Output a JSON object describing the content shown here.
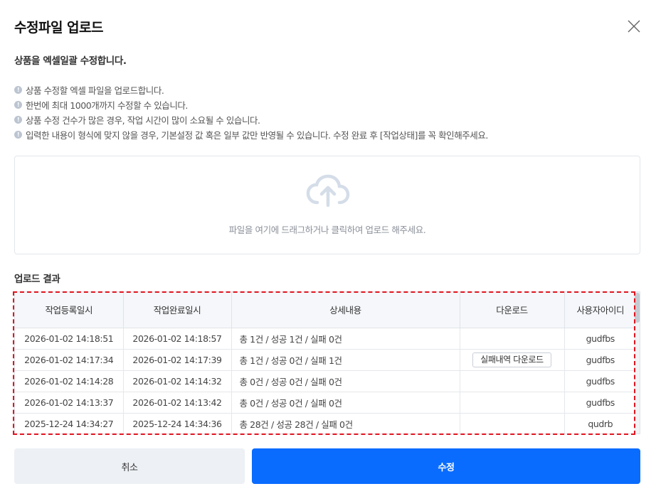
{
  "dialog": {
    "title": "수정파일 업로드",
    "subtitle": "상품을 엑셀일괄 수정합니다.",
    "notices": [
      "상품 수정할 엑셀 파일을 업로드합니다.",
      "한번에 최대 1000개까지 수정할 수 있습니다.",
      "상품 수정 건수가 많은 경우, 작업 시간이 많이 소요될 수 있습니다.",
      "입력한 내용이 형식에 맞지 않을 경우, 기본설정 값 혹은 일부 값만 반영될 수 있습니다. 수정 완료 후 [작업상태]를 꼭 확인해주세요."
    ],
    "info_icon_glyph": "!",
    "close_icon": "close-icon"
  },
  "dropzone": {
    "text": "파일을 여기에 드래그하거나 클릭하여 업로드 해주세요.",
    "icon": "cloud-upload-icon",
    "icon_color": "#d4dde8"
  },
  "results": {
    "title": "업로드 결과",
    "columns": [
      "작업등록일시",
      "작업완료일시",
      "상세내용",
      "다운로드",
      "사용자아이디"
    ],
    "rows": [
      {
        "registered": "2026-01-02 14:18:51",
        "completed": "2026-01-02 14:18:57",
        "detail": "총 1건 / 성공 1건 / 실패 0건",
        "download": "",
        "user": "gudfbs"
      },
      {
        "registered": "2026-01-02 14:17:34",
        "completed": "2026-01-02 14:17:39",
        "detail": "총 1건 / 성공 0건 / 실패 1건",
        "download": "실패내역 다운로드",
        "user": "gudfbs"
      },
      {
        "registered": "2026-01-02 14:14:28",
        "completed": "2026-01-02 14:14:32",
        "detail": "총 0건 / 성공 0건 / 실패 0건",
        "download": "",
        "user": "gudfbs"
      },
      {
        "registered": "2026-01-02 14:13:37",
        "completed": "2026-01-02 14:13:42",
        "detail": "총 0건 / 성공 0건 / 실패 0건",
        "download": "",
        "user": "gudfbs"
      },
      {
        "registered": "2025-12-24 14:34:27",
        "completed": "2025-12-24 14:34:36",
        "detail": "총 28건 / 성공 28건 / 실패 0건",
        "download": "",
        "user": "qudrb"
      }
    ]
  },
  "footer": {
    "cancel_label": "취소",
    "submit_label": "수정"
  },
  "colors": {
    "primary": "#0a6cff",
    "cancel_bg": "#edf0f4",
    "highlight": "#e0141f"
  }
}
